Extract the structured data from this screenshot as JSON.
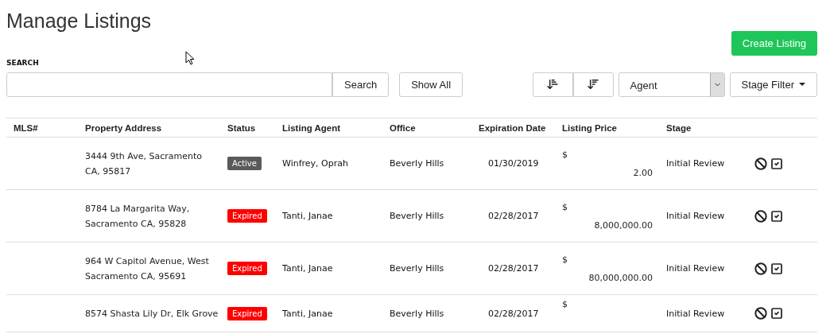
{
  "page": {
    "title": "Manage Listings"
  },
  "create_button": "Create Listing",
  "search": {
    "label": "SEARCH",
    "button": "Search"
  },
  "show_all_button": "Show All",
  "agent_select": {
    "value": "Agent"
  },
  "stage_filter": {
    "label": "Stage Filter"
  },
  "table": {
    "columns": [
      "MLS#",
      "Property Address",
      "Status",
      "Listing Agent",
      "Office",
      "Expiration Date",
      "Listing Price",
      "Stage"
    ],
    "rows": [
      {
        "address": [
          "3444 9th Ave, Sacramento",
          "CA, 95817"
        ],
        "status": {
          "label": "Active",
          "kind": "active"
        },
        "agent": "Winfrey, Oprah",
        "office": "Beverly Hills",
        "expiration": "01/30/2019",
        "currency": "$",
        "price": "2.00",
        "stage": "Initial Review"
      },
      {
        "address": [
          "8784 La Margarita Way,",
          "Sacramento CA, 95828"
        ],
        "status": {
          "label": "Expired",
          "kind": "expired"
        },
        "agent": "Tanti, Janae",
        "office": "Beverly Hills",
        "expiration": "02/28/2017",
        "currency": "$",
        "price": "8,000,000.00",
        "stage": "Initial Review"
      },
      {
        "address": [
          "964 W Capitol Avenue, West",
          "Sacramento CA, 95691"
        ],
        "status": {
          "label": "Expired",
          "kind": "expired"
        },
        "agent": "Tanti, Janae",
        "office": "Beverly Hills",
        "expiration": "02/28/2017",
        "currency": "$",
        "price": "80,000,000.00",
        "stage": "Initial Review"
      },
      {
        "address": [
          "8574 Shasta Lily Dr, Elk Grove"
        ],
        "status": {
          "label": "Expired",
          "kind": "expired"
        },
        "agent": "Tanti, Janae",
        "office": "Beverly Hills",
        "expiration": "02/28/2017",
        "currency": "$",
        "stage": "Initial Review"
      }
    ]
  }
}
